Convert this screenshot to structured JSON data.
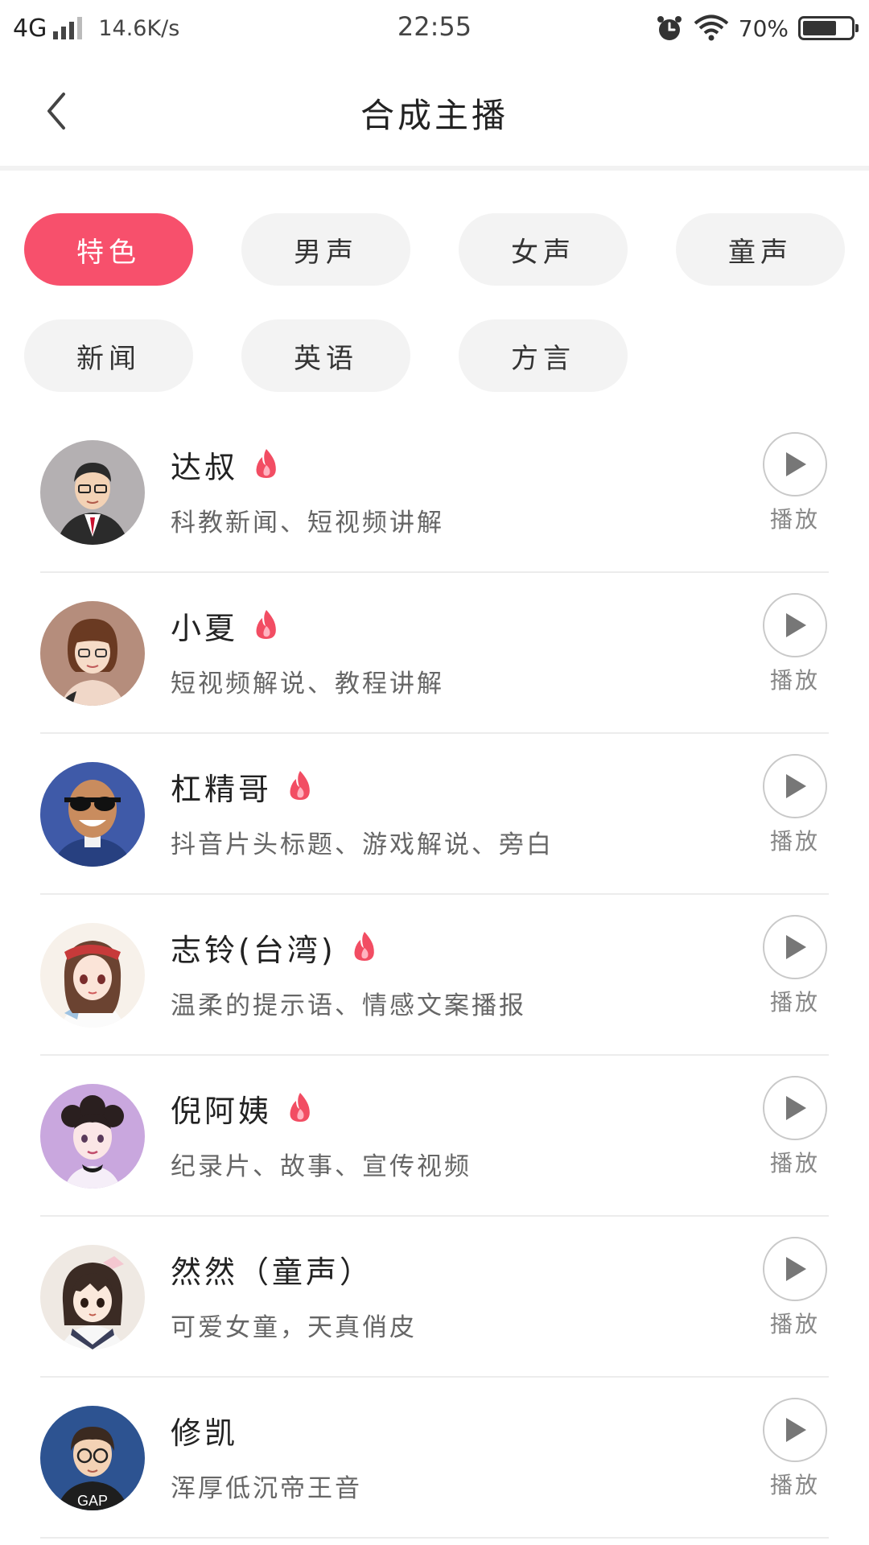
{
  "status_bar": {
    "network": "4G",
    "speed": "14.6K/s",
    "time": "22:55",
    "battery_percent": "70%",
    "battery_level": 0.7,
    "icons": [
      "signal-icon",
      "alarm-icon",
      "wifi-icon",
      "battery-icon"
    ]
  },
  "header": {
    "title": "合成主播",
    "back_icon": "chevron-left-icon"
  },
  "categories": [
    {
      "label": "特色",
      "active": true
    },
    {
      "label": "男声",
      "active": false
    },
    {
      "label": "女声",
      "active": false
    },
    {
      "label": "童声",
      "active": false
    },
    {
      "label": "新闻",
      "active": false
    },
    {
      "label": "英语",
      "active": false
    },
    {
      "label": "方言",
      "active": false
    }
  ],
  "anchors": [
    {
      "name": "达叔",
      "hot": true,
      "desc": "科教新闻、短视频讲解",
      "play_label": "播放"
    },
    {
      "name": "小夏",
      "hot": true,
      "desc": "短视频解说、教程讲解",
      "play_label": "播放"
    },
    {
      "name": "杠精哥",
      "hot": true,
      "desc": "抖音片头标题、游戏解说、旁白",
      "play_label": "播放"
    },
    {
      "name": "志铃(台湾)",
      "hot": true,
      "desc": "温柔的提示语、情感文案播报",
      "play_label": "播放"
    },
    {
      "name": "倪阿姨",
      "hot": true,
      "desc": "纪录片、故事、宣传视频",
      "play_label": "播放"
    },
    {
      "name": "然然（童声）",
      "hot": false,
      "desc": "可爱女童，天真俏皮",
      "play_label": "播放"
    },
    {
      "name": "修凯",
      "hot": false,
      "desc": "浑厚低沉帝王音",
      "play_label": "播放"
    }
  ],
  "colors": {
    "accent": "#f7506c",
    "pill_bg": "#f3f3f3",
    "flame": "#f24d63"
  }
}
